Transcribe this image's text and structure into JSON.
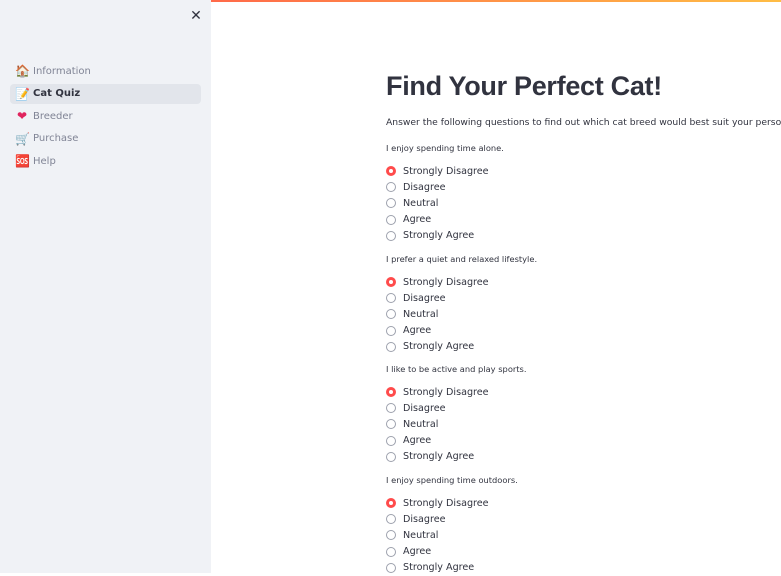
{
  "sidebar": {
    "close_glyph": "✕",
    "items": [
      {
        "label": "Information",
        "icon": "house-icon",
        "glyph": "🏠",
        "active": false
      },
      {
        "label": "Cat Quiz",
        "icon": "memo-icon",
        "glyph": "📝",
        "active": true
      },
      {
        "label": "Breeder",
        "icon": "heart-icon",
        "glyph": "❤",
        "active": false
      },
      {
        "label": "Purchase",
        "icon": "shopping-cart-icon",
        "glyph": "🛒",
        "active": false
      },
      {
        "label": "Help",
        "icon": "sos-icon",
        "glyph": "🆘",
        "active": false
      }
    ]
  },
  "main": {
    "title": "Find Your Perfect Cat!",
    "intro": "Answer the following questions to find out which cat breed would best suit your personality.",
    "options": [
      "Strongly Disagree",
      "Disagree",
      "Neutral",
      "Agree",
      "Strongly Agree"
    ],
    "questions": [
      {
        "label": "I enjoy spending time alone.",
        "selected": "Strongly Disagree"
      },
      {
        "label": "I prefer a quiet and relaxed lifestyle.",
        "selected": "Strongly Disagree"
      },
      {
        "label": "I like to be active and play sports.",
        "selected": "Strongly Disagree"
      },
      {
        "label": "I enjoy spending time outdoors.",
        "selected": "Strongly Disagree"
      }
    ]
  },
  "colors": {
    "accent": "#ff4b4b",
    "sidebar_bg": "#f0f2f6",
    "text": "#31333f"
  }
}
